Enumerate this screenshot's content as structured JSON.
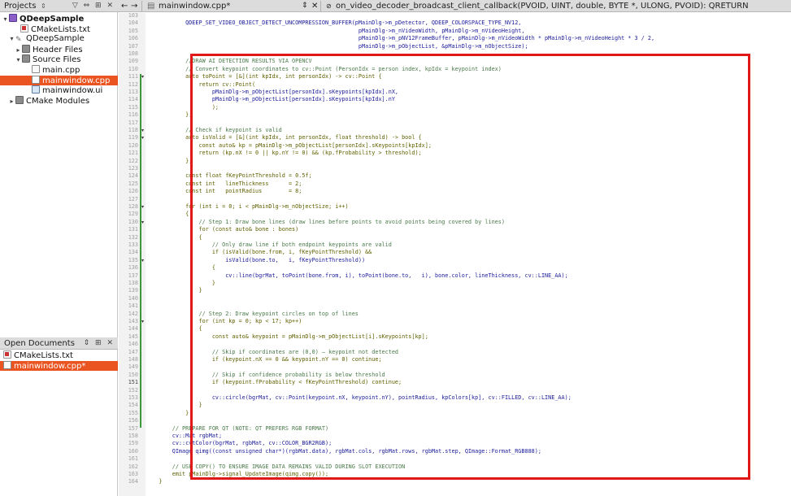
{
  "projects_panel": {
    "title": "Projects",
    "tree": [
      {
        "label": "QDeepSample",
        "arrow": "▾",
        "icon": "project-icon",
        "bold": true
      },
      {
        "label": "CMakeLists.txt",
        "arrow": "",
        "icon": "cmake-file-icon"
      },
      {
        "label": "QDeepSample",
        "arrow": "▾",
        "icon": "wrench-icon"
      },
      {
        "label": "Header Files",
        "arrow": "▸",
        "icon": "folder-icon"
      },
      {
        "label": "Source Files",
        "arrow": "▾",
        "icon": "folder-icon"
      },
      {
        "label": "main.cpp",
        "arrow": "",
        "icon": "file-icon"
      },
      {
        "label": "mainwindow.cpp",
        "arrow": "",
        "icon": "file-icon",
        "selected": true
      },
      {
        "label": "mainwindow.ui",
        "arrow": "",
        "icon": "ui-file-icon"
      },
      {
        "label": "CMake Modules",
        "arrow": "▸",
        "icon": "folder-icon"
      }
    ]
  },
  "open_documents_panel": {
    "title": "Open Documents",
    "docs": [
      {
        "label": "CMakeLists.txt",
        "selected": false
      },
      {
        "label": "mainwindow.cpp*",
        "selected": true
      }
    ]
  },
  "toolbar": {
    "file_tab": "mainwindow.cpp*",
    "function_selector": "on_video_decoder_broadcast_client_callback(PVOID, UINT, double, BYTE *, ULONG, PVOID): QRETURN"
  },
  "editor": {
    "current_line_number": "151",
    "line_numbers": [
      "103",
      "104",
      "105",
      "106",
      "107",
      "108",
      "109",
      "110",
      "111",
      "112",
      "113",
      "114",
      "115",
      "116",
      "117",
      "118",
      "119",
      "120",
      "121",
      "122",
      "123",
      "124",
      "125",
      "126",
      "127",
      "128",
      "129",
      "130",
      "131",
      "132",
      "133",
      "134",
      "135",
      "136",
      "137",
      "138",
      "139",
      "140",
      "141",
      "142",
      "143",
      "144",
      "145",
      "146",
      "147",
      "148",
      "149",
      "150",
      "151",
      "152",
      "153",
      "154",
      "155",
      "156",
      "157",
      "158",
      "159",
      "160",
      "161",
      "162",
      "163",
      "164"
    ],
    "code_lines": [
      "",
      "            QDEEP_SET_VIDEO_OBJECT_DETECT_UNCOMPRESSION_BUFFER(pMainDlg->m_pDetector, QDEEP_COLORSPACE_TYPE_NV12,",
      "                                                                pMainDlg->m_nVideoWidth, pMainDlg->m_nVideoHeight,",
      "                                                                pMainDlg->m_pNV12FrameBuffer, pMainDlg->m_nVideoWidth * pMainDlg->m_nVideoHeight * 3 / 2,",
      "                                                                pMainDlg->m_pObjectList, &pMainDlg->m_nObjectSize);",
      "",
      "            //DRAW AI DETECTION RESULTS VIA OPENCV",
      "            // Convert keypoint coordinates to cv::Point (PersonIdx = person index, kpIdx = keypoint index)",
      "            auto toPoint = [&](int kpIdx, int personIdx) -> cv::Point {",
      "                return cv::Point(",
      "                    pMainDlg->m_pObjectList[personIdx].sKeypoints[kpIdx].nX,",
      "                    pMainDlg->m_pObjectList[personIdx].sKeypoints[kpIdx].nY",
      "                    );",
      "            };",
      "",
      "            // Check if keypoint is valid",
      "            auto isValid = [&](int kpIdx, int personIdx, float threshold) -> bool {",
      "                const auto& kp = pMainDlg->m_pObjectList[personIdx].sKeypoints[kpIdx];",
      "                return (kp.nX != 0 || kp.nY != 0) && (kp.fProbability > threshold);",
      "            };",
      "",
      "            const float fKeyPointThreshold = 0.5f;",
      "            const int   lineThickness      = 2;",
      "            const int   pointRadius        = 8;",
      "",
      "            for (int i = 0; i < pMainDlg->m_nObjectSize; i++)",
      "            {",
      "                // Step 1: Draw bone lines (draw lines before points to avoid points being covered by lines)",
      "                for (const auto& bone : bones)",
      "                {",
      "                    // Only draw line if both endpoint keypoints are valid",
      "                    if (isValid(bone.from, i, fKeyPointThreshold) &&",
      "                        isValid(bone.to,   i, fKeyPointThreshold))",
      "                    {",
      "                        cv::line(bgrMat, toPoint(bone.from, i), toPoint(bone.to,   i), bone.color, lineThickness, cv::LINE_AA);",
      "                    }",
      "                }",
      "",
      "",
      "                // Step 2: Draw keypoint circles on top of lines",
      "                for (int kp = 0; kp < 17; kp++)",
      "                {",
      "                    const auto& keypoint = pMainDlg->m_pObjectList[i].sKeypoints[kp];",
      "",
      "                    // Skip if coordinates are (0,0) — keypoint not detected",
      "                    if (keypoint.nX == 0 && keypoint.nY == 0) continue;",
      "",
      "                    // Skip if confidence probability is below threshold",
      "                    if (keypoint.fProbability < fKeyPointThreshold) continue;",
      "",
      "                    cv::circle(bgrMat, cv::Point(keypoint.nX, keypoint.nY), pointRadius, kpColors[kp], cv::FILLED, cv::LINE_AA);",
      "                }",
      "            }",
      "",
      "        // PREPARE FOR QT (NOTE: QT PREFERS RGB FORMAT)",
      "        cv::Mat rgbMat;",
      "        cv::cvtColor(bgrMat, rgbMat, cv::COLOR_BGR2RGB);",
      "        QImage qimg((const unsigned char*)(rgbMat.data), rgbMat.cols, rgbMat.rows, rgbMat.step, QImage::Format_RGB888);",
      "",
      "        // USE COPY() TO ENSURE IMAGE DATA REMAINS VALID DURING SLOT EXECUTION",
      "        emit pMainDlg->signal_UpdateImage(qimg.copy());",
      "    }"
    ]
  },
  "colors": {
    "selection_accent": "#e95420",
    "highlight_box": "#e01818",
    "comment": "#4a7a4a",
    "identifier": "#1a1a9a",
    "change_bar": "#3a9a3a"
  }
}
